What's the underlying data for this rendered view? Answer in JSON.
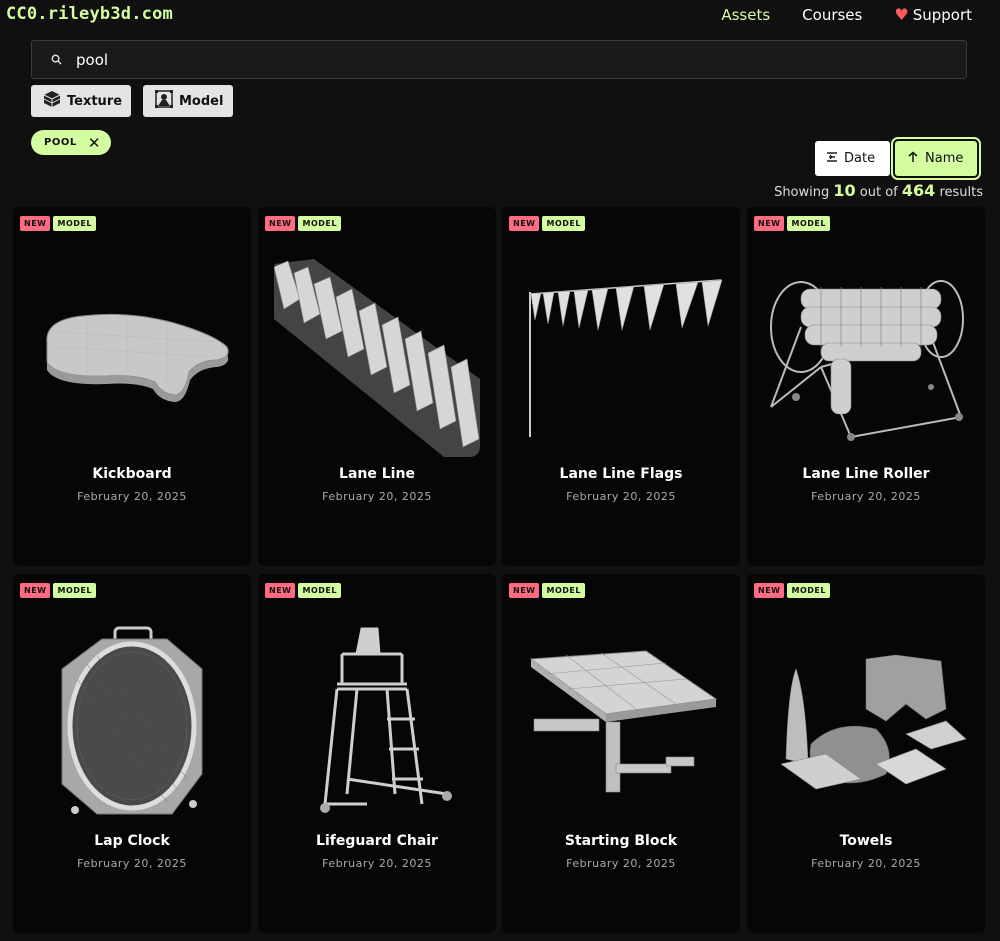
{
  "header": {
    "logo": "CC0.rileyb3d.com",
    "nav": [
      {
        "label": "Assets",
        "icon": ""
      },
      {
        "label": "Courses",
        "icon": ""
      },
      {
        "label": "Support",
        "icon": "heart-icon"
      }
    ]
  },
  "search": {
    "value": "pool",
    "placeholder": ""
  },
  "filters": {
    "texture_label": "Texture",
    "model_label": "Model"
  },
  "active_tag": {
    "label": "POOL"
  },
  "sort": {
    "date_label": "Date",
    "name_label": "Name",
    "active": "Name"
  },
  "results": {
    "prefix": "Showing",
    "shown": "10",
    "middle": "out of",
    "total": "464",
    "suffix": "results"
  },
  "colors": {
    "accent": "#d4fca0",
    "new_badge": "#ff6b81",
    "background": "#101010"
  },
  "assets": [
    {
      "title": "Kickboard",
      "date": "February 20, 2025",
      "badge_new": "NEW",
      "badge_type": "MODEL",
      "icon": "kickboard-thumbnail"
    },
    {
      "title": "Lane Line",
      "date": "February 20, 2025",
      "badge_new": "NEW",
      "badge_type": "MODEL",
      "icon": "lane-line-thumbnail"
    },
    {
      "title": "Lane Line Flags",
      "date": "February 20, 2025",
      "badge_new": "NEW",
      "badge_type": "MODEL",
      "icon": "lane-line-flags-thumbnail"
    },
    {
      "title": "Lane Line Roller",
      "date": "February 20, 2025",
      "badge_new": "NEW",
      "badge_type": "MODEL",
      "icon": "lane-line-roller-thumbnail"
    },
    {
      "title": "Lap Clock",
      "date": "February 20, 2025",
      "badge_new": "NEW",
      "badge_type": "MODEL",
      "icon": "lap-clock-thumbnail"
    },
    {
      "title": "Lifeguard Chair",
      "date": "February 20, 2025",
      "badge_new": "NEW",
      "badge_type": "MODEL",
      "icon": "lifeguard-chair-thumbnail"
    },
    {
      "title": "Starting Block",
      "date": "February 20, 2025",
      "badge_new": "NEW",
      "badge_type": "MODEL",
      "icon": "starting-block-thumbnail"
    },
    {
      "title": "Towels",
      "date": "February 20, 2025",
      "badge_new": "NEW",
      "badge_type": "MODEL",
      "icon": "towels-thumbnail"
    }
  ]
}
